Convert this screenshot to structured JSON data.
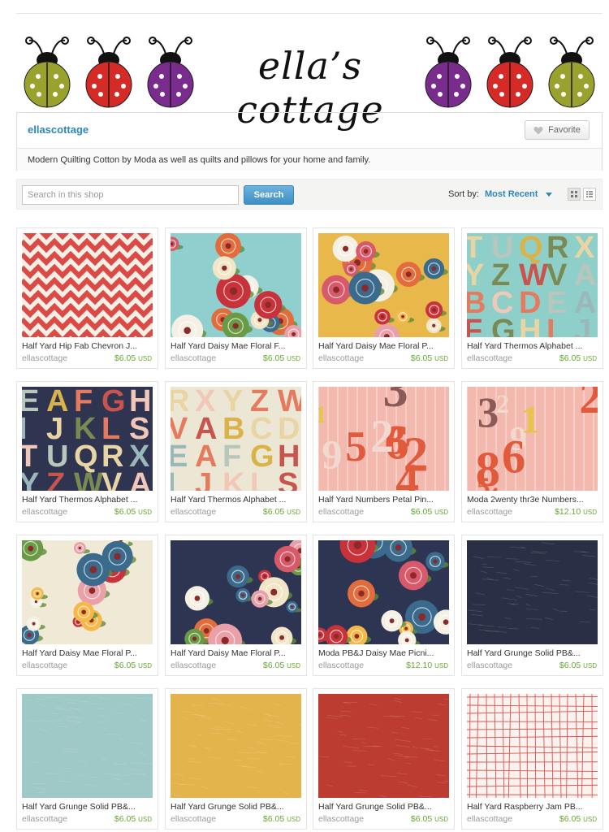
{
  "banner": {
    "title": "ella’s cottage",
    "bug_colors_left": [
      "#9aa22e",
      "#d52a26",
      "#7a2b8e"
    ],
    "bug_colors_right": [
      "#7a2b8e",
      "#d52a26",
      "#9aa22e"
    ]
  },
  "shop": {
    "name": "ellascottage",
    "favorite_label": "Favorite",
    "description": "Modern Quilting Cotton by Moda as well as quilts and pillows for your home and family."
  },
  "search": {
    "placeholder": "Search in this shop",
    "button_label": "Search",
    "sort_label": "Sort by:",
    "sort_value": "Most Recent"
  },
  "colors": {
    "accent": "#2e87b7",
    "price": "#66a832"
  },
  "listings": [
    {
      "title": "Half Yard Hip Fab Chevron J...",
      "seller": "ellascottage",
      "price": "$6.05",
      "currency": "USD",
      "pattern": "chevron"
    },
    {
      "title": "Half Yard Daisy Mae Floral F...",
      "seller": "ellascottage",
      "price": "$6.05",
      "currency": "USD",
      "pattern": "floral-aqua"
    },
    {
      "title": "Half Yard Daisy Mae Floral P...",
      "seller": "ellascottage",
      "price": "$6.05",
      "currency": "USD",
      "pattern": "floral-yellow"
    },
    {
      "title": "Half Yard Thermos Alphabet ...",
      "seller": "ellascottage",
      "price": "$6.05",
      "currency": "USD",
      "pattern": "alphabet-aqua"
    },
    {
      "title": "Half Yard Thermos Alphabet ...",
      "seller": "ellascottage",
      "price": "$6.05",
      "currency": "USD",
      "pattern": "alphabet-navy"
    },
    {
      "title": "Half Yard Thermos Alphabet ...",
      "seller": "ellascottage",
      "price": "$6.05",
      "currency": "USD",
      "pattern": "alphabet-cream"
    },
    {
      "title": "Half Yard Numbers Petal Pin...",
      "seller": "ellascottage",
      "price": "$6.05",
      "currency": "USD",
      "pattern": "numbers-pink"
    },
    {
      "title": "Moda 2wenty thr3e Numbers...",
      "seller": "ellascottage",
      "price": "$12.10",
      "currency": "USD",
      "pattern": "numbers-pink"
    },
    {
      "title": "Half Yard Daisy Mae Floral P...",
      "seller": "ellascottage",
      "price": "$6.05",
      "currency": "USD",
      "pattern": "floral-cream"
    },
    {
      "title": "Half Yard Daisy Mae Floral P...",
      "seller": "ellascottage",
      "price": "$6.05",
      "currency": "USD",
      "pattern": "floral-navy"
    },
    {
      "title": "Moda PB&J Daisy Mae Picni...",
      "seller": "ellascottage",
      "price": "$12.10",
      "currency": "USD",
      "pattern": "floral-navy"
    },
    {
      "title": "Half Yard Grunge Solid PB&...",
      "seller": "ellascottage",
      "price": "$6.05",
      "currency": "USD",
      "pattern": "solid-navy"
    },
    {
      "title": "Half Yard Grunge Solid PB&...",
      "seller": "ellascottage",
      "price": "$6.05",
      "currency": "USD",
      "pattern": "solid-aqua"
    },
    {
      "title": "Half Yard Grunge Solid PB&...",
      "seller": "ellascottage",
      "price": "$6.05",
      "currency": "USD",
      "pattern": "solid-mustard"
    },
    {
      "title": "Half Yard Grunge Solid PB&...",
      "seller": "ellascottage",
      "price": "$6.05",
      "currency": "USD",
      "pattern": "solid-red"
    },
    {
      "title": "Half Yard Raspberry Jam PB...",
      "seller": "ellascottage",
      "price": "$6.05",
      "currency": "USD",
      "pattern": "grid-red"
    }
  ]
}
